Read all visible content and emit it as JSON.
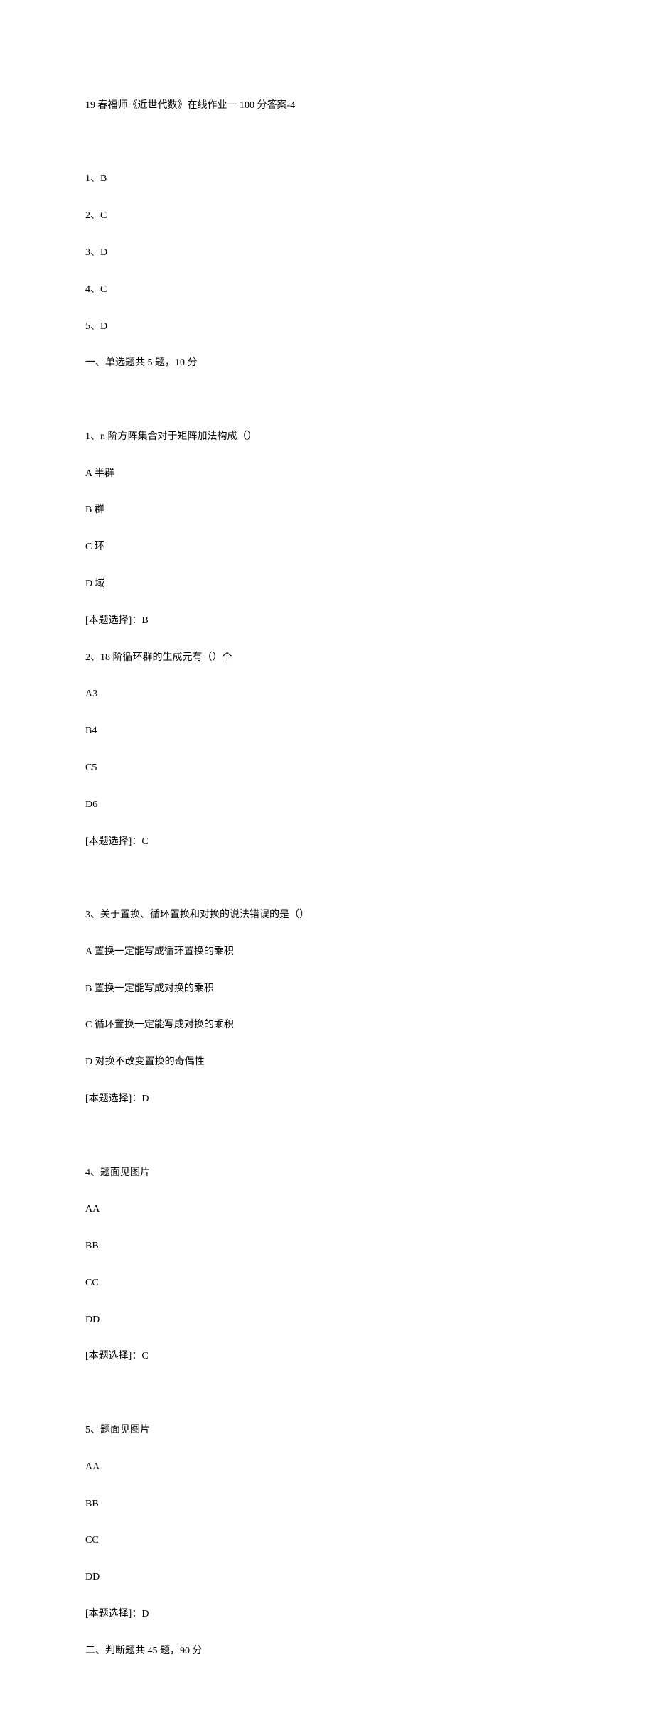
{
  "title": "19 春福师《近世代数》在线作业一 100 分答案-4",
  "answer_summary": [
    "1、B",
    "2、C",
    "3、D",
    "4、C",
    "5、D"
  ],
  "section1_header": "一、单选题共 5 题，10 分",
  "q1": {
    "stem": "1、n 阶方阵集合对于矩阵加法构成（）",
    "opts": [
      "A 半群",
      "B 群",
      "C 环",
      "D 域"
    ],
    "answer": "[本题选择]：B"
  },
  "q2": {
    "stem": "2、18 阶循环群的生成元有（）个",
    "opts": [
      "A3",
      "B4",
      "C5",
      "D6"
    ],
    "answer": "[本题选择]：C"
  },
  "q3": {
    "stem": "3、关于置换、循环置换和对换的说法错误的是（）",
    "opts": [
      "A 置换一定能写成循环置换的乘积",
      "B 置换一定能写成对换的乘积",
      "C 循环置换一定能写成对换的乘积",
      "D 对换不改变置换的奇偶性"
    ],
    "answer": "[本题选择]：D"
  },
  "q4": {
    "stem": "4、题面见图片",
    "opts": [
      "AA",
      "BB",
      "CC",
      "DD"
    ],
    "answer": "[本题选择]：C"
  },
  "q5": {
    "stem": "5、题面见图片",
    "opts": [
      "AA",
      "BB",
      "CC",
      "DD"
    ],
    "answer": "[本题选择]：D"
  },
  "section2_header": "二、判断题共 45 题，90 分"
}
